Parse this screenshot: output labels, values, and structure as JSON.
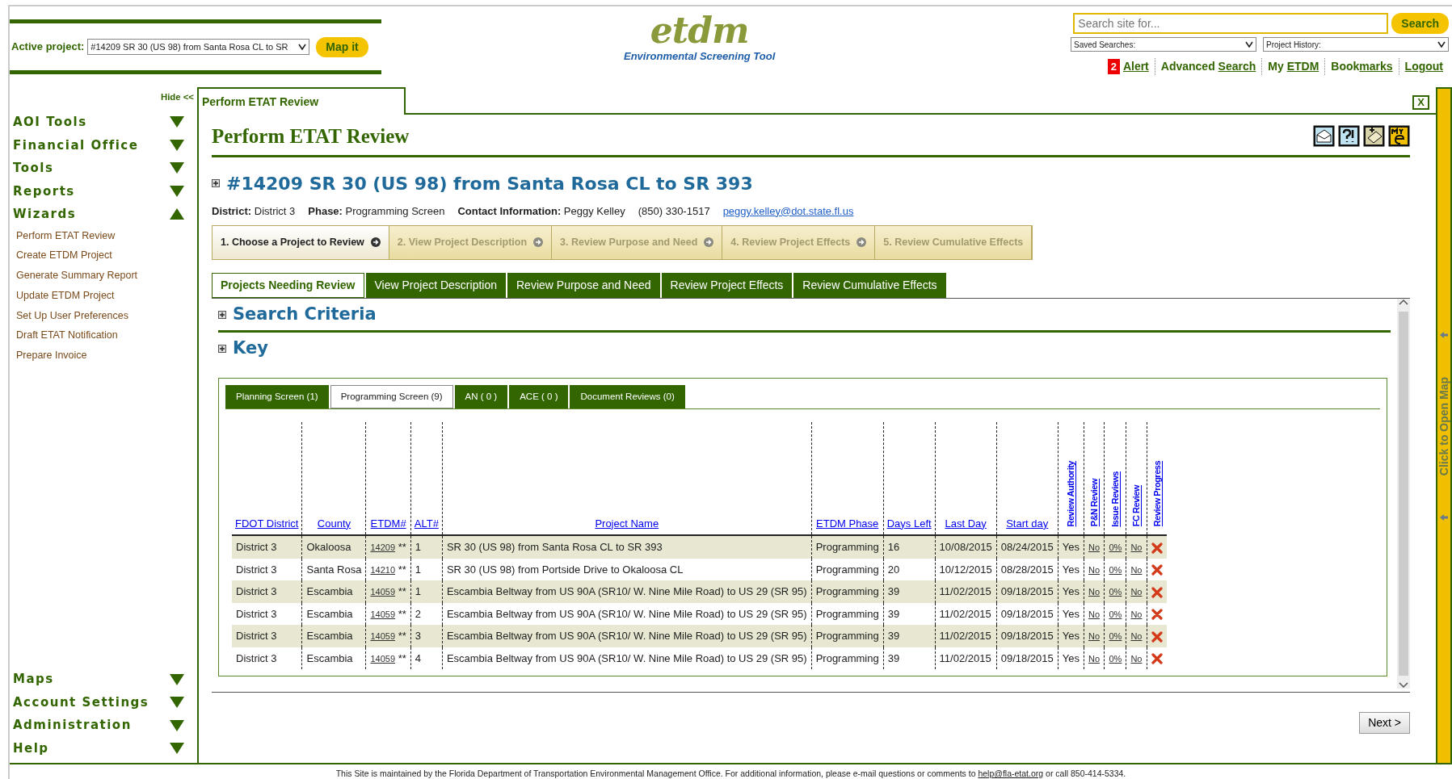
{
  "header": {
    "active_project": {
      "label": "Active project:",
      "value": "#14209 SR 30 (US 98) from Santa Rosa CL to SR",
      "button": "Map it"
    },
    "logo": {
      "title": "etdm",
      "subtitle": "Environmental Screening Tool"
    },
    "search": {
      "placeholder": "Search site for...",
      "button": "Search"
    },
    "dropdowns": [
      "Saved Searches:",
      "Project History:"
    ],
    "alert": {
      "count": "2",
      "label": "Alert"
    },
    "links": [
      {
        "plain": "Advanced ",
        "link": "Search"
      },
      {
        "plain": "My ",
        "link": "ETDM"
      },
      {
        "plain": "Book",
        "link": "marks"
      },
      {
        "link": "Logout"
      }
    ]
  },
  "sidebar": {
    "hide": "Hide <<",
    "sections": [
      {
        "label": "AOI Tools",
        "expanded": false
      },
      {
        "label": "Financial Office",
        "expanded": false
      },
      {
        "label": "Tools",
        "expanded": false
      },
      {
        "label": "Reports",
        "expanded": false
      },
      {
        "label": "Wizards",
        "expanded": true,
        "children": [
          "Perform ETAT Review",
          "Create ETDM Project",
          "Generate Summary Report",
          "Update ETDM Project",
          "Set Up User Preferences",
          "Draft ETAT Notification",
          "Prepare Invoice"
        ]
      }
    ],
    "bottom_sections": [
      {
        "label": "Maps",
        "expanded": false
      },
      {
        "label": "Account Settings",
        "expanded": false
      },
      {
        "label": "Administration",
        "expanded": false
      },
      {
        "label": "Help",
        "expanded": false
      }
    ]
  },
  "panel": {
    "tab": "Perform ETAT Review",
    "close": "X",
    "title": "Perform ETAT Review",
    "project": {
      "heading": "#14209 SR 30 (US 98) from Santa Rosa CL to SR 393",
      "info": [
        "**District:** District 3",
        "**Phase:** Programming Screen",
        "**Contact Information:** Peggy Kelley",
        "(850) 330-1517"
      ],
      "email": "peggy.kelley@dot.state.fl.us"
    },
    "steps": [
      {
        "label": "1. Choose a Project to Review",
        "selected": true
      },
      {
        "label": "2. View Project Description",
        "selected": false
      },
      {
        "label": "3. Review Purpose and Need",
        "selected": false
      },
      {
        "label": "4. Review Project Effects",
        "selected": false
      },
      {
        "label": "5. Review Cumulative Effects",
        "selected": false
      }
    ],
    "tabs": [
      {
        "label": "Projects Needing Review",
        "selected": true
      },
      {
        "label": "View Project Description",
        "selected": false
      },
      {
        "label": "Review Purpose and Need",
        "selected": false
      },
      {
        "label": "Review Project Effects",
        "selected": false
      },
      {
        "label": "Review Cumulative Effects",
        "selected": false
      }
    ],
    "sections": [
      "Search Criteria",
      "Key"
    ],
    "subtabs": [
      {
        "label": "Planning Screen (1)",
        "selected": false
      },
      {
        "label": "Programming Screen (9)",
        "selected": true
      },
      {
        "label": "AN ( 0 )",
        "selected": false
      },
      {
        "label": "ACE ( 0 )",
        "selected": false
      },
      {
        "label": "Document Reviews (0)",
        "selected": false
      }
    ],
    "table": {
      "columns": [
        {
          "label": "FDOT District",
          "vertical": false
        },
        {
          "label": "County",
          "vertical": false
        },
        {
          "label": "ETDM#",
          "vertical": false
        },
        {
          "label": "ALT#",
          "vertical": false
        },
        {
          "label": "Project Name",
          "vertical": false
        },
        {
          "label": "ETDM Phase",
          "vertical": false
        },
        {
          "label": "Days Left",
          "vertical": false
        },
        {
          "label": "Last Day",
          "vertical": false
        },
        {
          "label": "Start day",
          "vertical": false
        },
        {
          "label": "Review Authority",
          "vertical": true
        },
        {
          "label": "P&N Review",
          "vertical": true
        },
        {
          "label": "Issue Reviews",
          "vertical": true
        },
        {
          "label": "FC Review",
          "vertical": true
        },
        {
          "label": "Review Progress",
          "vertical": true
        }
      ],
      "rows": [
        {
          "district": "District 3",
          "county": "Okaloosa",
          "etdm": "14209",
          "mark": "**",
          "alt": "1",
          "name": "SR 30 (US 98) from Santa Rosa CL to SR 393",
          "phase": "Programming",
          "days_left": "16",
          "last_day": "10/08/2015",
          "start_day": "08/24/2015",
          "authority": "Yes",
          "pn": "No",
          "issues": "0%",
          "fc": "No"
        },
        {
          "district": "District 3",
          "county": "Santa Rosa",
          "etdm": "14210",
          "mark": "**",
          "alt": "1",
          "name": "SR 30 (US 98) from Portside Drive to Okaloosa CL",
          "phase": "Programming",
          "days_left": "20",
          "last_day": "10/12/2015",
          "start_day": "08/28/2015",
          "authority": "Yes",
          "pn": "No",
          "issues": "0%",
          "fc": "No"
        },
        {
          "district": "District 3",
          "county": "Escambia",
          "etdm": "14059",
          "mark": "**",
          "alt": "1",
          "name": "Escambia Beltway from US 90A (SR10/ W. Nine Mile Road) to US 29 (SR 95)",
          "phase": "Programming",
          "days_left": "39",
          "last_day": "11/02/2015",
          "start_day": "09/18/2015",
          "authority": "Yes",
          "pn": "No",
          "issues": "0%",
          "fc": "No"
        },
        {
          "district": "District 3",
          "county": "Escambia",
          "etdm": "14059",
          "mark": "**",
          "alt": "2",
          "name": "Escambia Beltway from US 90A (SR10/ W. Nine Mile Road) to US 29 (SR 95)",
          "phase": "Programming",
          "days_left": "39",
          "last_day": "11/02/2015",
          "start_day": "09/18/2015",
          "authority": "Yes",
          "pn": "No",
          "issues": "0%",
          "fc": "No"
        },
        {
          "district": "District 3",
          "county": "Escambia",
          "etdm": "14059",
          "mark": "**",
          "alt": "3",
          "name": "Escambia Beltway from US 90A (SR10/ W. Nine Mile Road) to US 29 (SR 95)",
          "phase": "Programming",
          "days_left": "39",
          "last_day": "11/02/2015",
          "start_day": "09/18/2015",
          "authority": "Yes",
          "pn": "No",
          "issues": "0%",
          "fc": "No"
        },
        {
          "district": "District 3",
          "county": "Escambia",
          "etdm": "14059",
          "mark": "**",
          "alt": "4",
          "name": "Escambia Beltway from US 90A (SR10/ W. Nine Mile Road) to US 29 (SR 95)",
          "phase": "Programming",
          "days_left": "39",
          "last_day": "11/02/2015",
          "start_day": "09/18/2015",
          "authority": "Yes",
          "pn": "No",
          "issues": "0%",
          "fc": "No"
        }
      ]
    },
    "next": "Next >"
  },
  "map_bar": "Click to Open Map",
  "footer": {
    "text": "This Site is maintained by the Florida Department of Transportation Environmental Management Office. For additional information, please e-mail questions or comments to ",
    "email": "help@fla-etat.org",
    "tail": " or call 850-414-5334."
  }
}
